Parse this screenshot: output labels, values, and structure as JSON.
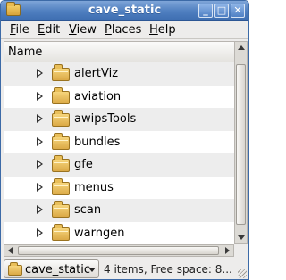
{
  "window": {
    "title": "cave_static",
    "buttons": {
      "minimize": "_",
      "maximize": "□",
      "close": "✕"
    }
  },
  "menu": {
    "items": [
      {
        "key": "F",
        "rest": "ile"
      },
      {
        "key": "E",
        "rest": "dit"
      },
      {
        "key": "V",
        "rest": "iew"
      },
      {
        "key": "P",
        "rest": "laces"
      },
      {
        "key": "H",
        "rest": "elp"
      }
    ]
  },
  "list": {
    "column_header": "Name",
    "items": [
      {
        "name": "alertViz"
      },
      {
        "name": "aviation"
      },
      {
        "name": "awipsTools"
      },
      {
        "name": "bundles"
      },
      {
        "name": "gfe"
      },
      {
        "name": "menus"
      },
      {
        "name": "scan"
      },
      {
        "name": "warngen"
      }
    ]
  },
  "statusbar": {
    "location": "cave_static",
    "status": "4 items, Free space: 8..."
  },
  "icons": {
    "folder": "folder-icon",
    "expander": "triangle-right-icon",
    "dropdown": "chevron-down-icon"
  },
  "colors": {
    "titlebar": "#4f7fc0",
    "folder": "#dba946",
    "row_alt": "#ededed"
  }
}
